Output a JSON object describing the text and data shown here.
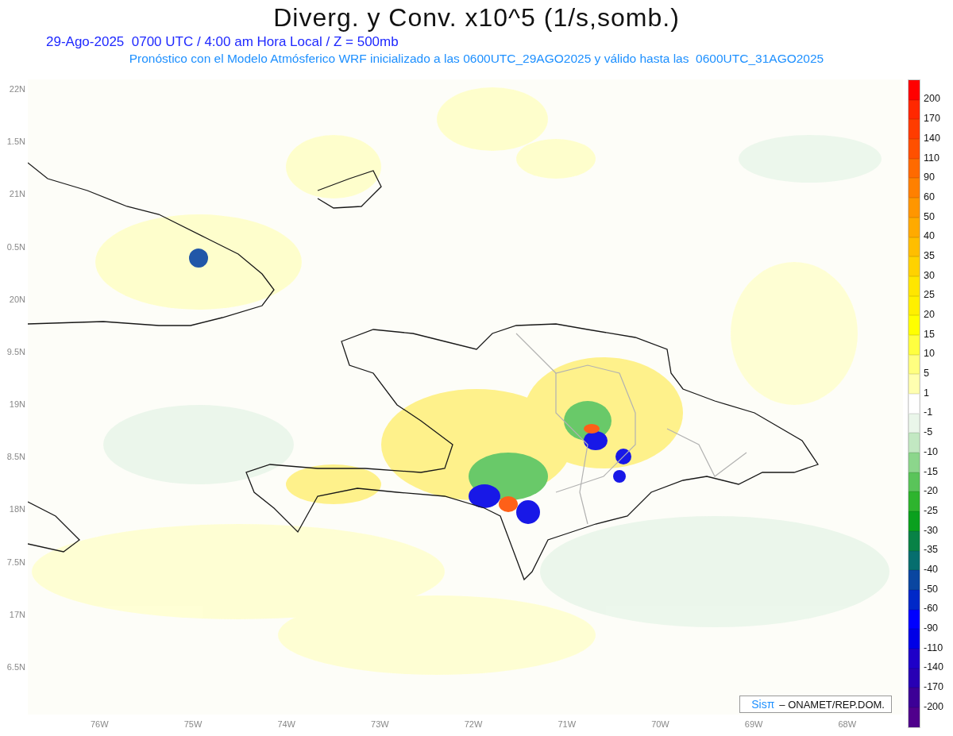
{
  "title": "Diverg. y Conv. x10^5 (1/s,somb.)",
  "subtitle": "29-Ago-2025  0700 UTC / 4:00 am Hora Local / Z = 500mb",
  "forecast_note": "Pronóstico con el Modelo Atmósferico WRF inicializado a las 0600UTC_29AGO2025 y válido hasta las  0600UTC_31AGO2025",
  "y_axis": {
    "ticks": [
      "22N",
      "1.5N",
      "21N",
      "0.5N",
      "20N",
      "9.5N",
      "19N",
      "8.5N",
      "18N",
      "7.5N",
      "17N",
      "6.5N"
    ]
  },
  "x_axis": {
    "ticks": [
      "76W",
      "75W",
      "74W",
      "73W",
      "72W",
      "71W",
      "70W",
      "69W",
      "68W"
    ]
  },
  "legend": {
    "bands": [
      {
        "color": "#ff0000"
      },
      {
        "color": "#ff2800"
      },
      {
        "color": "#ff3c00"
      },
      {
        "color": "#ff5000"
      },
      {
        "color": "#ff6a00"
      },
      {
        "color": "#ff8000"
      },
      {
        "color": "#ff9600"
      },
      {
        "color": "#ffaa00"
      },
      {
        "color": "#ffbe00"
      },
      {
        "color": "#ffd200"
      },
      {
        "color": "#ffe600"
      },
      {
        "color": "#fff000"
      },
      {
        "color": "#ffff00"
      },
      {
        "color": "#ffff40"
      },
      {
        "color": "#ffff80"
      },
      {
        "color": "#ffffb0"
      },
      {
        "color": "#ffffff"
      },
      {
        "color": "#eaf6ea"
      },
      {
        "color": "#c2e8c2"
      },
      {
        "color": "#8cd68c"
      },
      {
        "color": "#5ac45a"
      },
      {
        "color": "#2eb42e"
      },
      {
        "color": "#0aa01e"
      },
      {
        "color": "#088246"
      },
      {
        "color": "#066e6e"
      },
      {
        "color": "#0a46a0"
      },
      {
        "color": "#0028c8"
      },
      {
        "color": "#0000ff"
      },
      {
        "color": "#0000e6"
      },
      {
        "color": "#1e00c8"
      },
      {
        "color": "#2800b4"
      },
      {
        "color": "#3c0096"
      },
      {
        "color": "#50008c"
      }
    ],
    "labels": [
      "200",
      "170",
      "140",
      "110",
      "90",
      "60",
      "50",
      "40",
      "35",
      "30",
      "25",
      "20",
      "15",
      "10",
      "5",
      "1",
      "-1",
      "-5",
      "-10",
      "-15",
      "-20",
      "-25",
      "-30",
      "-35",
      "-40",
      "-50",
      "-60",
      "-90",
      "-110",
      "-140",
      "-170",
      "-200"
    ]
  },
  "credit": {
    "brand": "Sisπ",
    "text": "– ONAMET/REP.DOM."
  }
}
